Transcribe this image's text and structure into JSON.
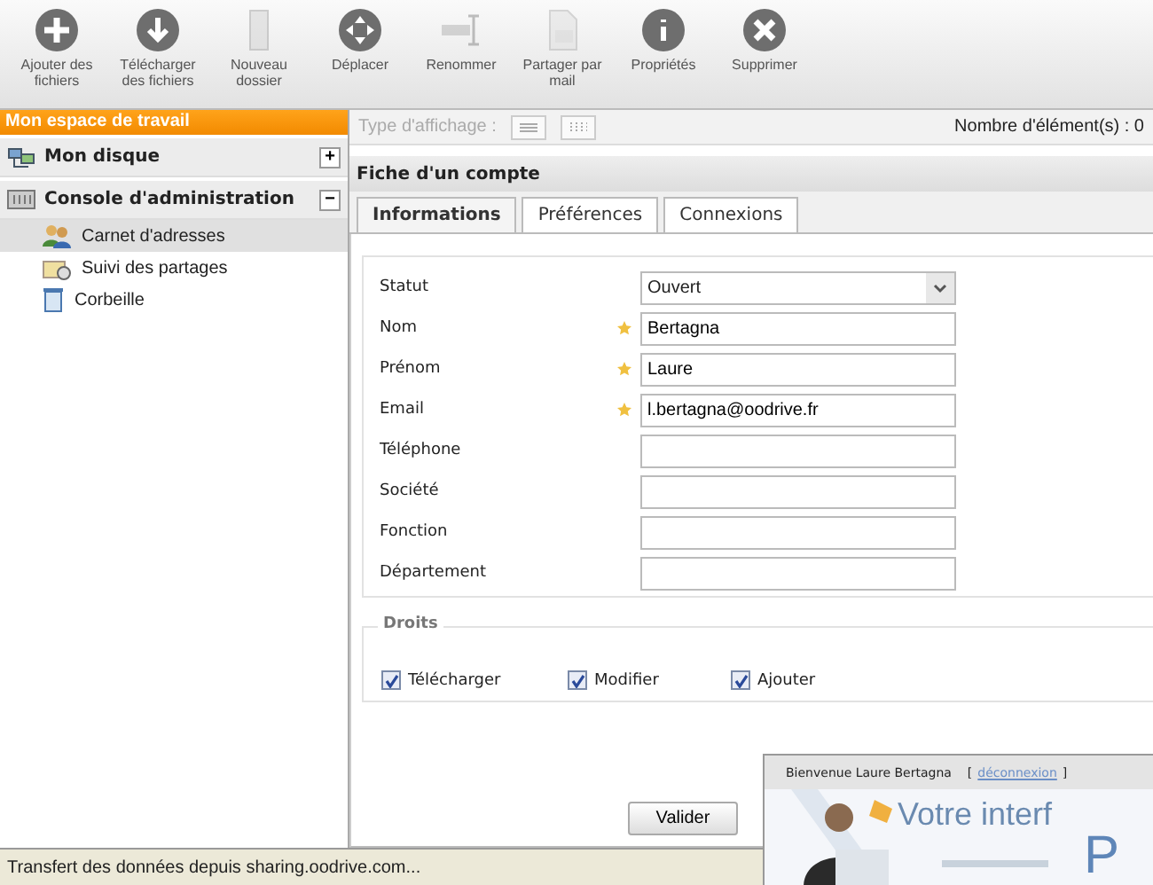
{
  "toolbar": [
    {
      "label": "Ajouter des\nfichiers",
      "kind": "add",
      "disabled": false
    },
    {
      "label": "Télécharger\ndes fichiers",
      "kind": "download",
      "disabled": false
    },
    {
      "label": "Nouveau\ndossier",
      "kind": "folder",
      "disabled": true
    },
    {
      "label": "Déplacer",
      "kind": "move",
      "disabled": false
    },
    {
      "label": "Renommer",
      "kind": "rename",
      "disabled": true
    },
    {
      "label": "Partager par\nmail",
      "kind": "share",
      "disabled": true
    },
    {
      "label": "Propriétés",
      "kind": "info",
      "disabled": false
    },
    {
      "label": "Supprimer",
      "kind": "delete",
      "disabled": false
    }
  ],
  "sidebar": {
    "title": "Mon espace de travail",
    "sections": [
      {
        "label": "Mon disque",
        "kind": "network",
        "toggle": "+"
      },
      {
        "label": "Console d'administration",
        "kind": "console",
        "toggle": "−",
        "children": [
          {
            "label": "Carnet d'adresses",
            "kind": "contacts",
            "selected": true
          },
          {
            "label": "Suivi des partages",
            "kind": "tracking",
            "selected": false
          },
          {
            "label": "Corbeille",
            "kind": "trash",
            "selected": false
          }
        ]
      }
    ]
  },
  "view_bar": {
    "label": "Type d'affichage :",
    "count": "Nombre d'élément(s) : 0"
  },
  "panel": {
    "title": "Fiche d'un compte",
    "tabs": [
      {
        "label": "Informations",
        "selected": true
      },
      {
        "label": "Préférences",
        "selected": false
      },
      {
        "label": "Connexions",
        "selected": false
      }
    ],
    "fields": [
      {
        "label": "Statut",
        "kind": "select",
        "required": false,
        "value": "Ouvert"
      },
      {
        "label": "Nom",
        "kind": "text",
        "required": true,
        "value": "Bertagna"
      },
      {
        "label": "Prénom",
        "kind": "text",
        "required": true,
        "value": "Laure"
      },
      {
        "label": "Email",
        "kind": "text",
        "required": true,
        "value": "l.bertagna@oodrive.fr"
      },
      {
        "label": "Téléphone",
        "kind": "text",
        "required": false
      },
      {
        "label": "Société",
        "kind": "text",
        "required": false
      },
      {
        "label": "Fonction",
        "kind": "text",
        "required": false
      },
      {
        "label": "Département",
        "kind": "text",
        "required": false
      }
    ],
    "rights": {
      "title": "Droits",
      "items": [
        {
          "label": "Télécharger",
          "checked": true
        },
        {
          "label": "Modifier",
          "checked": true
        },
        {
          "label": "Ajouter",
          "checked": true
        }
      ]
    },
    "buttons": [
      "Valider"
    ]
  },
  "status_bar": "Transfert des données depuis sharing.oodrive.com...",
  "overlay": {
    "welcome": "Bienvenue Laure Bertagna",
    "bracket_open": "[",
    "logout_link": "déconnexion",
    "bracket_close": "]",
    "banner_line_1": "Votre interf",
    "banner_line_2": "P"
  }
}
